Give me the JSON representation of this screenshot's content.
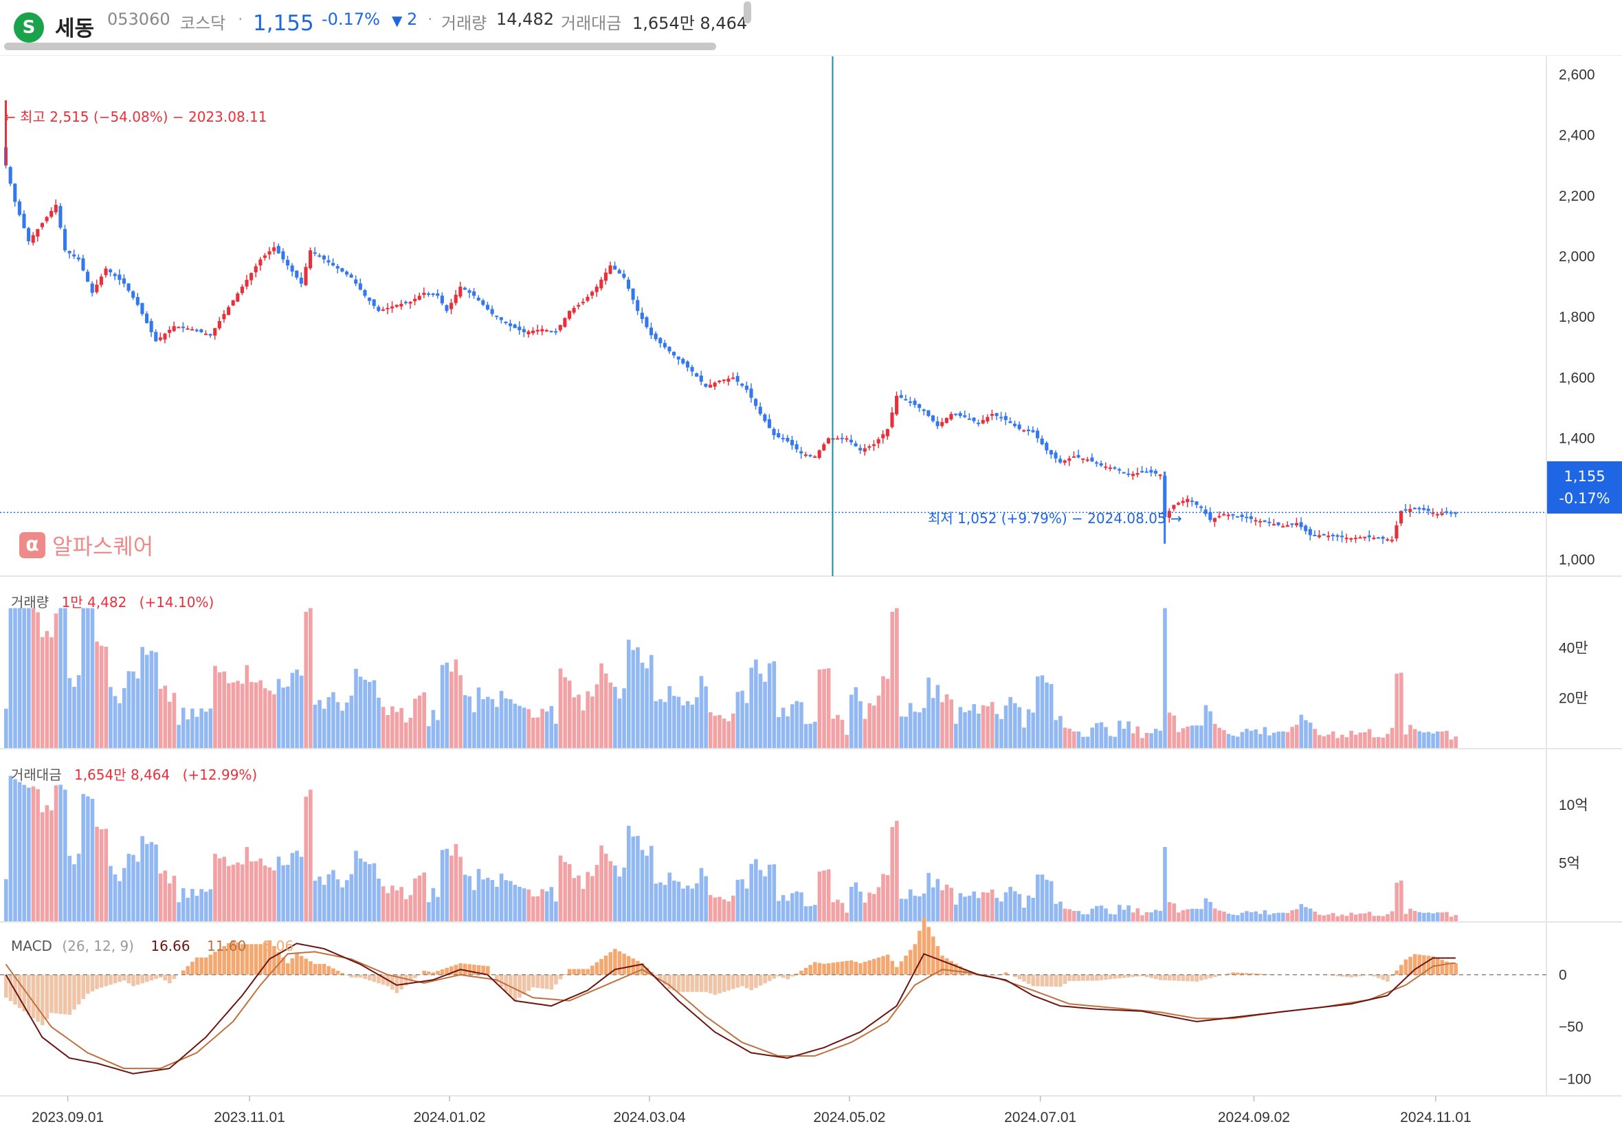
{
  "header": {
    "logo_glyph": "S",
    "name": "세동",
    "code": "053060",
    "market": "코스닥",
    "dot": "·",
    "price": "1,155",
    "change_pct": "-0.17%",
    "change_arrow": "▼",
    "change_abs": "2",
    "volume_label": "거래량",
    "volume_value": "14,482",
    "amount_label": "거래대금",
    "amount_value": "1,654만 8,464"
  },
  "brand": {
    "icon": "α",
    "text": "알파스퀘어"
  },
  "price_tag": {
    "price": "1,155",
    "pct": "-0.17%"
  },
  "colors": {
    "up": "#e8303a",
    "down": "#3478f0",
    "up_light": "#f2a2a4",
    "down_light": "#92b8f4",
    "macd_line": "#6b1410",
    "signal_line": "#c0703c",
    "hist_pos": "#f4a870",
    "hist_neg": "#f0c4a6",
    "crosshair": "#1a8aa0"
  },
  "annotations": {
    "high": "← 최고 2,515 (−54.08%) − 2023.08.11",
    "low": "최저 1,052 (+9.79%) − 2024.08.05 →"
  },
  "panels": {
    "volume": {
      "label": "거래량",
      "value": "1만 4,482",
      "pct": "(+14.10%)"
    },
    "amount": {
      "label": "거래대금",
      "value": "1,654만 8,464",
      "pct": "(+12.99%)"
    },
    "macd": {
      "label": "MACD",
      "params": "(26, 12, 9)",
      "macd": "16.66",
      "signal": "11.60",
      "hist": "5.06"
    }
  },
  "chart_data": {
    "type": "candlestick",
    "price_axis": {
      "ticks": [
        "2,600",
        "2,400",
        "2,200",
        "2,000",
        "1,800",
        "1,600",
        "1,400",
        "1,200",
        "1,000"
      ],
      "values": [
        2600,
        2400,
        2200,
        2000,
        1800,
        1600,
        1400,
        1200,
        1000
      ],
      "ylim": [
        945,
        2660
      ]
    },
    "volume_axis": {
      "ticks": [
        "40만",
        "20만"
      ],
      "values": [
        400000,
        200000
      ],
      "ylim": [
        0,
        600000
      ]
    },
    "amount_axis": {
      "ticks": [
        "10억",
        "5억"
      ],
      "values": [
        10,
        5
      ],
      "ylim": [
        0,
        13
      ]
    },
    "macd_axis": {
      "ticks": [
        "0",
        "−50",
        "−100"
      ],
      "values": [
        0,
        -50,
        -100
      ],
      "ylim": [
        -115,
        50
      ]
    },
    "x_ticks": [
      "2023.09.01",
      "2023.11.01",
      "2024.01.02",
      "2024.03.04",
      "2024.05.02",
      "2024.07.01",
      "2024.09.02",
      "2024.11.01"
    ],
    "x_tick_bars": [
      14,
      54,
      98,
      142,
      186,
      228,
      275,
      315
    ],
    "last_price": 1155,
    "high": {
      "value": 2515,
      "bar": 0
    },
    "low": {
      "value": 1052,
      "bar": 255
    },
    "crosshair_bar": 182,
    "bar_count": 320,
    "close_keypoints": [
      [
        0,
        2300
      ],
      [
        2,
        2180
      ],
      [
        5,
        2050
      ],
      [
        8,
        2110
      ],
      [
        11,
        2170
      ],
      [
        13,
        2020
      ],
      [
        16,
        1990
      ],
      [
        19,
        1880
      ],
      [
        22,
        1960
      ],
      [
        26,
        1910
      ],
      [
        29,
        1840
      ],
      [
        33,
        1720
      ],
      [
        37,
        1770
      ],
      [
        41,
        1760
      ],
      [
        45,
        1740
      ],
      [
        48,
        1810
      ],
      [
        52,
        1900
      ],
      [
        56,
        1990
      ],
      [
        59,
        2030
      ],
      [
        62,
        1970
      ],
      [
        65,
        1910
      ],
      [
        67,
        2020
      ],
      [
        70,
        1990
      ],
      [
        73,
        1960
      ],
      [
        76,
        1930
      ],
      [
        79,
        1870
      ],
      [
        82,
        1820
      ],
      [
        86,
        1840
      ],
      [
        89,
        1850
      ],
      [
        92,
        1880
      ],
      [
        95,
        1870
      ],
      [
        97,
        1820
      ],
      [
        100,
        1900
      ],
      [
        103,
        1870
      ],
      [
        107,
        1810
      ],
      [
        111,
        1770
      ],
      [
        114,
        1750
      ],
      [
        118,
        1760
      ],
      [
        121,
        1750
      ],
      [
        124,
        1820
      ],
      [
        127,
        1850
      ],
      [
        130,
        1900
      ],
      [
        133,
        1970
      ],
      [
        136,
        1930
      ],
      [
        139,
        1820
      ],
      [
        142,
        1740
      ],
      [
        145,
        1700
      ],
      [
        148,
        1660
      ],
      [
        151,
        1620
      ],
      [
        154,
        1570
      ],
      [
        157,
        1590
      ],
      [
        160,
        1600
      ],
      [
        163,
        1560
      ],
      [
        166,
        1480
      ],
      [
        169,
        1410
      ],
      [
        172,
        1390
      ],
      [
        175,
        1350
      ],
      [
        178,
        1340
      ],
      [
        181,
        1400
      ],
      [
        185,
        1400
      ],
      [
        188,
        1360
      ],
      [
        191,
        1380
      ],
      [
        194,
        1430
      ],
      [
        196,
        1540
      ],
      [
        199,
        1520
      ],
      [
        202,
        1490
      ],
      [
        205,
        1440
      ],
      [
        208,
        1480
      ],
      [
        211,
        1470
      ],
      [
        214,
        1450
      ],
      [
        217,
        1480
      ],
      [
        220,
        1460
      ],
      [
        223,
        1430
      ],
      [
        226,
        1420
      ],
      [
        229,
        1360
      ],
      [
        232,
        1320
      ],
      [
        235,
        1340
      ],
      [
        238,
        1330
      ],
      [
        241,
        1310
      ],
      [
        244,
        1300
      ],
      [
        247,
        1280
      ],
      [
        251,
        1290
      ],
      [
        254,
        1280
      ],
      [
        255,
        1140
      ],
      [
        257,
        1180
      ],
      [
        260,
        1200
      ],
      [
        263,
        1170
      ],
      [
        265,
        1130
      ],
      [
        268,
        1150
      ],
      [
        272,
        1140
      ],
      [
        275,
        1130
      ],
      [
        278,
        1120
      ],
      [
        281,
        1110
      ],
      [
        284,
        1120
      ],
      [
        287,
        1080
      ],
      [
        290,
        1080
      ],
      [
        293,
        1075
      ],
      [
        296,
        1070
      ],
      [
        299,
        1075
      ],
      [
        302,
        1070
      ],
      [
        305,
        1065
      ],
      [
        307,
        1160
      ],
      [
        310,
        1170
      ],
      [
        313,
        1160
      ],
      [
        315,
        1150
      ],
      [
        317,
        1155
      ]
    ],
    "macd_keypoints": [
      [
        0,
        0
      ],
      [
        8,
        -60
      ],
      [
        14,
        -80
      ],
      [
        20,
        -85
      ],
      [
        28,
        -95
      ],
      [
        36,
        -90
      ],
      [
        44,
        -60
      ],
      [
        52,
        -20
      ],
      [
        58,
        15
      ],
      [
        64,
        30
      ],
      [
        70,
        25
      ],
      [
        78,
        10
      ],
      [
        86,
        -10
      ],
      [
        94,
        -5
      ],
      [
        100,
        5
      ],
      [
        106,
        0
      ],
      [
        112,
        -25
      ],
      [
        120,
        -30
      ],
      [
        128,
        -15
      ],
      [
        134,
        5
      ],
      [
        140,
        10
      ],
      [
        148,
        -25
      ],
      [
        156,
        -55
      ],
      [
        164,
        -75
      ],
      [
        172,
        -80
      ],
      [
        180,
        -70
      ],
      [
        188,
        -55
      ],
      [
        196,
        -30
      ],
      [
        202,
        20
      ],
      [
        208,
        10
      ],
      [
        214,
        0
      ],
      [
        220,
        -5
      ],
      [
        226,
        -20
      ],
      [
        232,
        -30
      ],
      [
        240,
        -33
      ],
      [
        250,
        -35
      ],
      [
        256,
        -40
      ],
      [
        262,
        -45
      ],
      [
        268,
        -42
      ],
      [
        276,
        -38
      ],
      [
        286,
        -33
      ],
      [
        296,
        -28
      ],
      [
        304,
        -20
      ],
      [
        310,
        5
      ],
      [
        314,
        16
      ],
      [
        318,
        16
      ]
    ],
    "signal_keypoints": [
      [
        0,
        10
      ],
      [
        10,
        -50
      ],
      [
        18,
        -75
      ],
      [
        26,
        -90
      ],
      [
        34,
        -90
      ],
      [
        42,
        -75
      ],
      [
        50,
        -45
      ],
      [
        56,
        -10
      ],
      [
        62,
        20
      ],
      [
        68,
        22
      ],
      [
        76,
        15
      ],
      [
        84,
        0
      ],
      [
        92,
        -8
      ],
      [
        100,
        0
      ],
      [
        108,
        -5
      ],
      [
        116,
        -22
      ],
      [
        124,
        -25
      ],
      [
        132,
        -10
      ],
      [
        140,
        5
      ],
      [
        146,
        -10
      ],
      [
        154,
        -40
      ],
      [
        162,
        -65
      ],
      [
        170,
        -78
      ],
      [
        178,
        -78
      ],
      [
        186,
        -65
      ],
      [
        194,
        -45
      ],
      [
        200,
        -10
      ],
      [
        206,
        5
      ],
      [
        212,
        2
      ],
      [
        218,
        -3
      ],
      [
        226,
        -15
      ],
      [
        234,
        -28
      ],
      [
        244,
        -32
      ],
      [
        254,
        -36
      ],
      [
        262,
        -42
      ],
      [
        270,
        -42
      ],
      [
        280,
        -36
      ],
      [
        290,
        -31
      ],
      [
        300,
        -24
      ],
      [
        308,
        -10
      ],
      [
        314,
        8
      ],
      [
        318,
        11
      ]
    ]
  }
}
